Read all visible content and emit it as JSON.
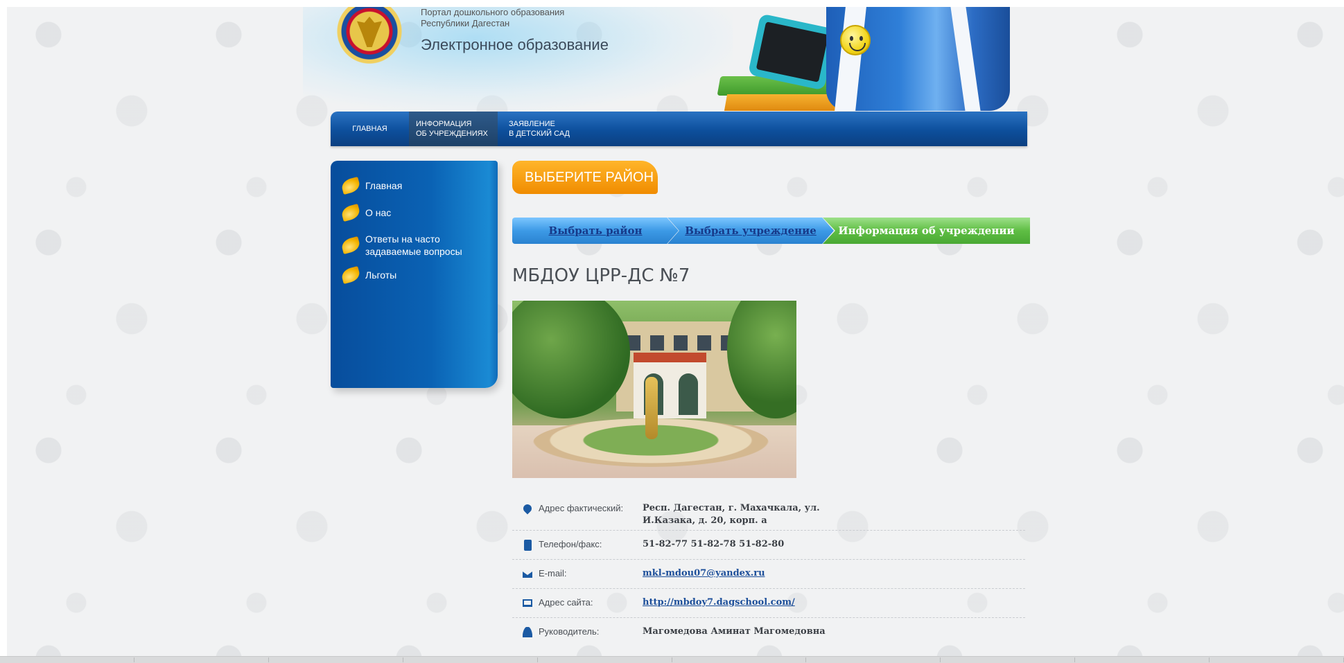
{
  "header": {
    "portal_line1": "Портал дошкольного образования",
    "portal_line2": "Республики Дагестан",
    "site_title": "Электронное образование"
  },
  "topnav": [
    {
      "line1": "ГЛАВНАЯ",
      "line2": "",
      "active": false
    },
    {
      "line1": "ИНФОРМАЦИЯ",
      "line2": "ОБ УЧРЕЖДЕНИЯХ",
      "active": true
    },
    {
      "line1": "ЗАЯВЛЕНИЕ",
      "line2": "В ДЕТСКИЙ САД",
      "active": false
    }
  ],
  "sidebar": {
    "items": [
      {
        "label": "Главная",
        "icon": "leaf-icon"
      },
      {
        "label": "О нас",
        "icon": "leaf-icon"
      },
      {
        "label": "Ответы на часто задаваемые вопросы",
        "icon": "leaf-icon"
      },
      {
        "label": "Льготы",
        "icon": "leaf-icon"
      }
    ]
  },
  "main": {
    "choose_district_label": "ВЫБЕРИТЕ РАЙОН",
    "steps": [
      {
        "label": "Выбрать район",
        "is_link": true
      },
      {
        "label": "Выбрать учреждение",
        "is_link": true
      },
      {
        "label": "Информация об учреждении",
        "is_link": false
      }
    ],
    "institution_title": "МБДОУ ЦРР-ДС №7",
    "photo_icon": "institution-photo",
    "info": [
      {
        "icon": "location-pin-icon",
        "label": "Адрес фактический:",
        "value": "Респ. Дагестан, г. Махачкала, ул. И.Казака, д. 20, корп. а",
        "is_link": false
      },
      {
        "icon": "phone-icon",
        "label": "Телефон/факс:",
        "value": "51-82-77 51-82-78 51-82-80",
        "is_link": false
      },
      {
        "icon": "mail-icon",
        "label": "E-mail:",
        "value": "mkl-mdou07@yandex.ru",
        "is_link": true
      },
      {
        "icon": "monitor-icon",
        "label": "Адрес сайта:",
        "value": "http://mbdoy7.dagschool.com/",
        "is_link": true
      },
      {
        "icon": "user-icon",
        "label": "Руководитель:",
        "value": "Магомедова Аминат Магомедовна",
        "is_link": false
      }
    ]
  },
  "colors": {
    "nav_blue": "#0d4f9c",
    "accent_orange": "#f08c00",
    "step_blue": "#3d9ae6",
    "step_green": "#5fbe44",
    "link_blue": "#1d4f9a"
  }
}
